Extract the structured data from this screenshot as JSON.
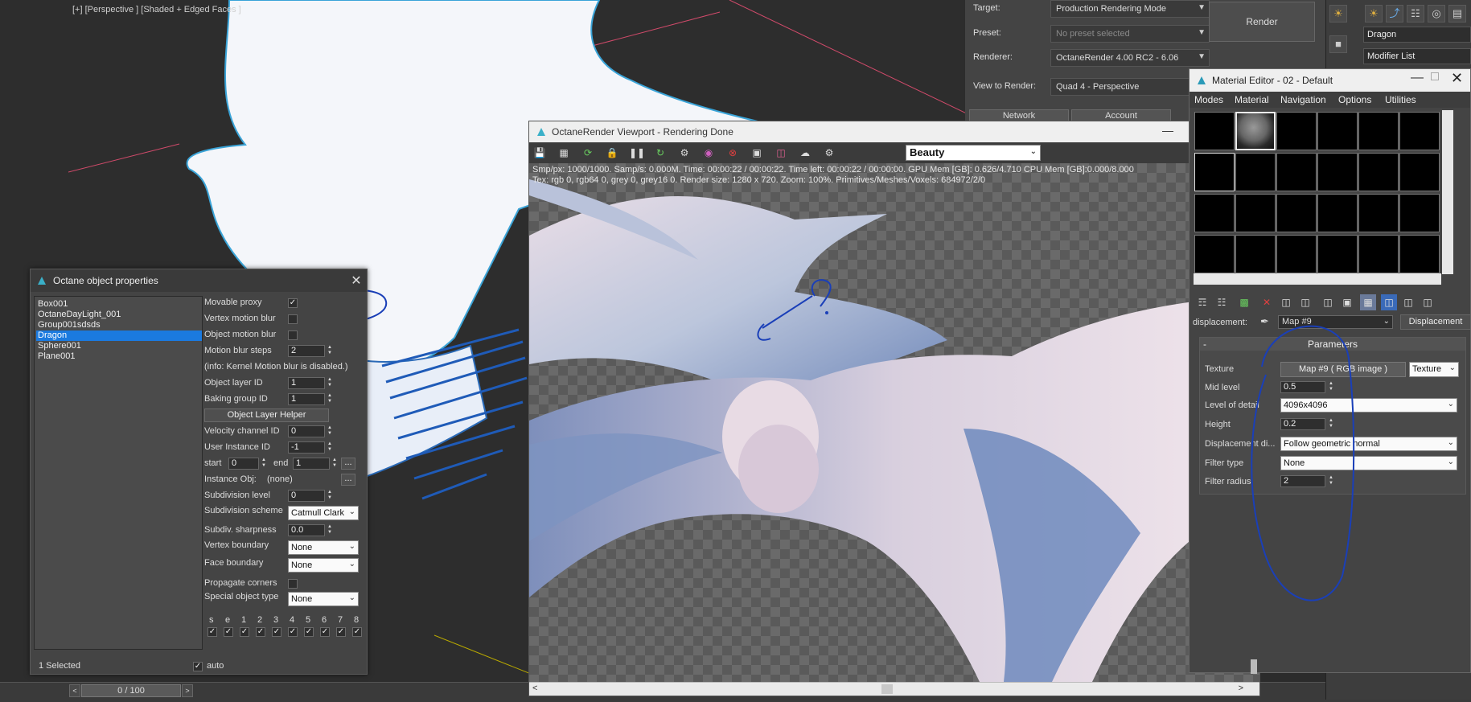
{
  "viewport": {
    "label": "[+] [Perspective ] [Shaded + Edged Faces ]",
    "time_slider": "0 / 100",
    "time_prev": "<",
    "time_next": ">"
  },
  "render_setup": {
    "rows": [
      {
        "label": "Target:",
        "value": "Production Rendering Mode",
        "dim": false
      },
      {
        "label": "Preset:",
        "value": "No preset selected",
        "dim": true
      },
      {
        "label": "Renderer:",
        "value": "OctaneRender 4.00 RC2 - 6.06",
        "dim": false
      },
      {
        "label": "View to Render:",
        "value": "Quad 4 - Perspective",
        "dim": false
      }
    ],
    "render_button": "Render",
    "tab_network": "Network",
    "tab_account": "Account"
  },
  "command_panel": {
    "object_name": "Dragon",
    "modifier_list": "Modifier List"
  },
  "octane_object_properties": {
    "title": "Octane object properties",
    "objects": [
      "Box001",
      "OctaneDayLight_001",
      "Group001sdsds",
      "Dragon",
      "Sphere001",
      "Plane001"
    ],
    "selected_index": 3,
    "movable_proxy": "Movable proxy",
    "vertex_motion_blur": "Vertex motion blur",
    "object_motion_blur": "Object motion blur",
    "motion_blur_steps_label": "Motion blur steps",
    "motion_blur_steps": "2",
    "info": "(info: Kernel Motion blur is disabled.)",
    "object_layer_id_label": "Object layer ID",
    "object_layer_id": "1",
    "baking_group_id_label": "Baking group ID",
    "baking_group_id": "1",
    "object_layer_helper": "Object Layer Helper",
    "velocity_channel_id_label": "Velocity channel ID",
    "velocity_channel_id": "0",
    "user_instance_id_label": "User Instance ID",
    "user_instance_id": "-1",
    "start_label": "start",
    "start_value": "0",
    "end_label": "end",
    "end_value": "1",
    "ellipsis": "...",
    "instance_obj_label": "Instance Obj:",
    "instance_obj_value": "(none)",
    "subdivision_level_label": "Subdivision level",
    "subdivision_level": "0",
    "subdivision_scheme_label": "Subdivision scheme",
    "subdivision_scheme": "Catmull Clark",
    "subdiv_sharpness_label": "Subdiv. sharpness",
    "subdiv_sharpness": "0.0",
    "vertex_boundary_label": "Vertex boundary",
    "vertex_boundary": "None",
    "face_boundary_label": "Face boundary",
    "face_boundary": "None",
    "propagate_corners_label": "Propagate corners",
    "special_object_type_label": "Special object type",
    "special_object_type": "None",
    "visibility_flags": [
      "s",
      "e",
      "1",
      "2",
      "3",
      "4",
      "5",
      "6",
      "7",
      "8"
    ],
    "status": "1 Selected",
    "auto_label": "auto"
  },
  "octane_viewport": {
    "title": "OctaneRender Viewport - Rendering Done",
    "pass": "Beauty",
    "stats_line1": "Smp/px: 1000/1000.   Samp/s: 0.000M.   Time: 00:00:22 / 00:00:22.   Time left: 00:00:22 / 00:00:00.   GPU Mem [GB]: 0.626/4.710   CPU Mem [GB]:0.000/8.000",
    "stats_line2": "Tex: rgb 0, rgb64 0, grey 0, grey16 0.   Render size: 1280 x 720.   Zoom: 100%.   Primitives/Meshes/Voxels: 684972/2/0",
    "scroll_left": "<",
    "scroll_right": ">"
  },
  "material_editor": {
    "title": "Material Editor - 02 - Default",
    "menu": [
      "Modes",
      "Material",
      "Navigation",
      "Options",
      "Utilities"
    ],
    "displacement_label": "displacement:",
    "map_name": "Map #9",
    "displacement_button": "Displacement",
    "rollout_title": "Parameters",
    "rollout_minus": "-",
    "texture_label": "Texture",
    "texture_value": "Map #9  ( RGB image )",
    "texture_type": "Texture",
    "mid_level_label": "Mid level",
    "mid_level": "0.5",
    "level_of_detail_label": "Level of detail",
    "level_of_detail": "4096x4096",
    "height_label": "Height",
    "height": "0.2",
    "displacement_direction_label": "Displacement di...",
    "displacement_direction": "Follow geometric normal",
    "filter_type_label": "Filter type",
    "filter_type": "None",
    "filter_radius_label": "Filter radius",
    "filter_radius": "2"
  },
  "colors": {
    "selection_blue": "#1b7adf",
    "annotation_blue": "#1a3fb8",
    "max_dark_bg": "#2b2b2b"
  }
}
